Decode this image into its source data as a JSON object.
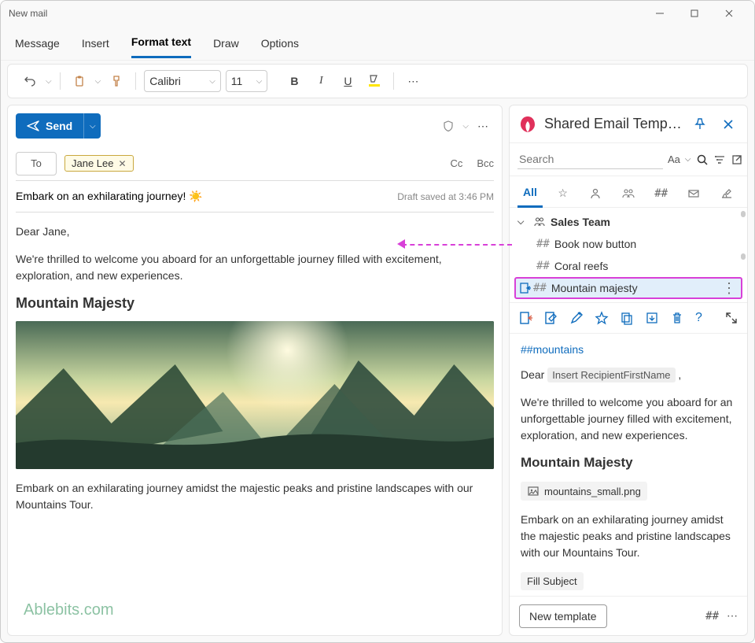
{
  "titlebar": {
    "title": "New mail"
  },
  "menubar": {
    "tabs": [
      "Message",
      "Insert",
      "Format text",
      "Draw",
      "Options"
    ],
    "active_index": 2
  },
  "toolbar": {
    "font_name": "Calibri",
    "font_size": "11"
  },
  "send": {
    "label": "Send"
  },
  "compose": {
    "to_label": "To",
    "chip_name": "Jane Lee",
    "cc_label": "Cc",
    "bcc_label": "Bcc",
    "subject": "Embark on an exhilarating journey! ☀️",
    "draft_status": "Draft saved at 3:46 PM"
  },
  "email": {
    "greeting": "Dear Jane,",
    "intro": "We're thrilled to welcome you aboard for an unforgettable journey filled with excitement, exploration, and new experiences.",
    "heading": "Mountain Majesty",
    "body2": "Embark on an exhilarating journey amidst the majestic peaks and pristine landscapes with our Mountains Tour.",
    "watermark": "Ablebits.com"
  },
  "side": {
    "title": "Shared Email Temp…",
    "search_placeholder": "Search",
    "filter_all": "All",
    "folder": "Sales Team",
    "items": [
      {
        "label": "Book now button"
      },
      {
        "label": "Coral reefs"
      },
      {
        "label": "Mountain majesty"
      }
    ],
    "preview": {
      "tag": "##mountains",
      "dear": "Dear",
      "insert_chip": "Insert RecipientFirstName",
      "comma": ",",
      "intro": "We're thrilled to welcome you aboard for an unforgettable journey filled with excitement, exploration, and new experiences.",
      "heading": "Mountain Majesty",
      "attachment": "mountains_small.png",
      "body2": "Embark on an exhilarating journey amidst the majestic peaks and pristine landscapes with our Mountains Tour.",
      "fill_subject": "Fill Subject"
    },
    "footer": {
      "new_template": "New template"
    }
  }
}
